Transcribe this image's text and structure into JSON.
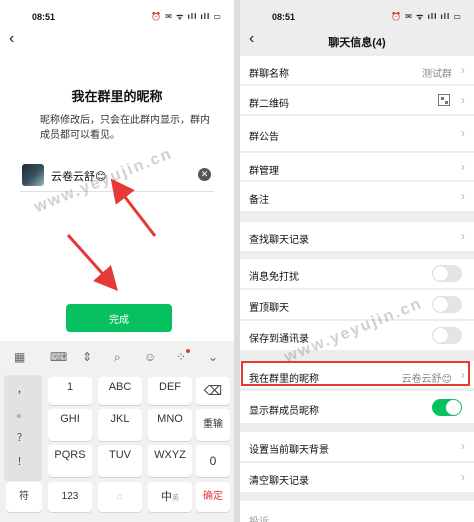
{
  "status_bar": {
    "time": "08:51",
    "icons": "⏰ ✉ ᯤ ıll ıll ▭"
  },
  "left": {
    "heading": "我在群里的昵称",
    "description": "昵称修改后，只会在此群内显示，群内成员都可以看见。",
    "nickname": "云卷云舒😊",
    "done_label": "完成",
    "watermark": "www.yeyujin.cn",
    "keyboard": {
      "toolbar_icons": [
        "keyboard-grid-icon",
        "keyboard-icon",
        "cursor-icon",
        "search-icon",
        "emoji-icon",
        "apps-icon",
        "collapse-icon"
      ],
      "side_keys": [
        "，",
        "。",
        "？",
        "！"
      ],
      "rows": [
        [
          {
            "sub": "",
            "main": "1"
          },
          {
            "sub": "",
            "main": "ABC"
          },
          {
            "sub": "",
            "main": "DEF"
          }
        ],
        [
          {
            "sub": "",
            "main": "GHI"
          },
          {
            "sub": "",
            "main": "JKL"
          },
          {
            "sub": "",
            "main": "MNO"
          }
        ],
        [
          {
            "sub": "",
            "main": "PQRS"
          },
          {
            "sub": "",
            "main": "TUV"
          },
          {
            "sub": "",
            "main": "WXYZ"
          }
        ]
      ],
      "backspace": "⌫",
      "reenter": "重输",
      "zero": "0",
      "symbol": "符",
      "num": "123",
      "space": "",
      "lang": "中",
      "lang_sub": "英",
      "confirm": "确定"
    }
  },
  "right": {
    "title": "聊天信息(4)",
    "rows": [
      {
        "label": "群聊名称",
        "value": "测试群"
      },
      {
        "label": "群二维码",
        "value": ""
      },
      {
        "label": "群公告",
        "value": ""
      },
      {
        "label": "群管理",
        "value": ""
      },
      {
        "label": "备注",
        "value": ""
      },
      {
        "label": "查找聊天记录",
        "value": ""
      },
      {
        "label": "消息免打扰",
        "toggle": false
      },
      {
        "label": "置顶聊天",
        "toggle": false
      },
      {
        "label": "保存到通讯录",
        "toggle": false
      },
      {
        "label": "我在群里的昵称",
        "value": "云卷云舒😊"
      },
      {
        "label": "显示群成员昵称",
        "toggle": true
      },
      {
        "label": "设置当前聊天背景",
        "value": ""
      },
      {
        "label": "清空聊天记录",
        "value": ""
      },
      {
        "label": "投诉",
        "value": ""
      }
    ],
    "watermark": "www.yeyujin.cn"
  },
  "colors": {
    "accent": "#07c160",
    "highlight": "#e53935"
  }
}
